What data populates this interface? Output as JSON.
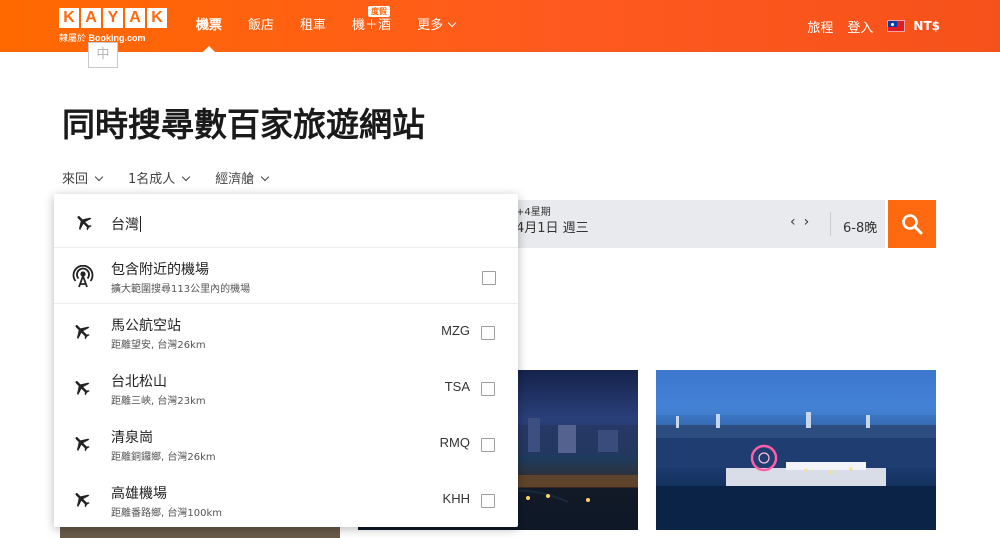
{
  "header": {
    "logo_letters": [
      "K",
      "A",
      "Y",
      "A",
      "K"
    ],
    "logo_sub_prefix": "隸屬於",
    "logo_sub_brand": "Booking.com",
    "nav": [
      {
        "label": "機票",
        "active": true
      },
      {
        "label": "飯店"
      },
      {
        "label": "租車"
      },
      {
        "label": "機＋酒",
        "badge": "度假"
      },
      {
        "label": "更多"
      }
    ],
    "trips_label": "旅程",
    "login_label": "登入",
    "currency": "NT$",
    "accent_color": "#ff690f"
  },
  "headline": "同時搜尋數百家旅遊網站",
  "options": {
    "trip_type": "來回",
    "travelers": "1名成人",
    "cabin": "經濟艙"
  },
  "searchbar": {
    "date_hint": "+4星期",
    "date_value": "4月1日 週三",
    "nights": "6-8晚"
  },
  "dropdown": {
    "input_value": "台灣",
    "ime_indicator": "中",
    "nearby": {
      "title": "包含附近的機場",
      "subtitle": "擴大範圍搜尋113公里內的機場"
    },
    "airports": [
      {
        "name": "馬公航空站",
        "detail": "距離望安, 台灣26km",
        "code": "MZG"
      },
      {
        "name": "台北松山",
        "detail": "距離三峽, 台灣23km",
        "code": "TSA"
      },
      {
        "name": "清泉崗",
        "detail": "距離銅鑼鄉, 台灣26km",
        "code": "RMQ"
      },
      {
        "name": "高雄機場",
        "detail": "距離番路鄉, 台灣100km",
        "code": "KHH"
      }
    ]
  }
}
